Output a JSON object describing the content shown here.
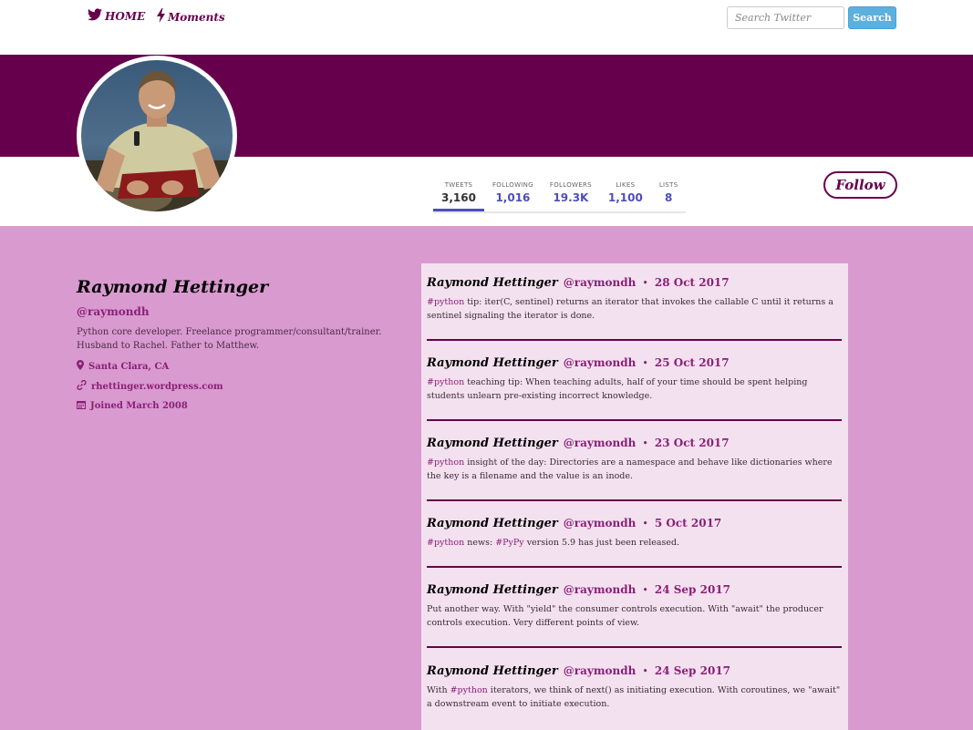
{
  "nav": {
    "home_label": "HOME",
    "moments_label": "Moments",
    "home_icon": "twitter-bird-icon",
    "moments_icon": "lightning-bolt-icon"
  },
  "search": {
    "placeholder": "Search Twitter",
    "button_label": "Search"
  },
  "colors": {
    "brand": "#66004c",
    "content_bg": "#d99ad0",
    "feed_bg": "#f4e1f0",
    "accent_link": "#8a1f77",
    "search_button": "#5bb0de"
  },
  "stats": [
    {
      "label": "TWEETS",
      "value": "3,160",
      "active": true
    },
    {
      "label": "FOLLOWING",
      "value": "1,016",
      "active": false
    },
    {
      "label": "FOLLOWERS",
      "value": "19.3K",
      "active": false
    },
    {
      "label": "LIKES",
      "value": "1,100",
      "active": false
    },
    {
      "label": "LISTS",
      "value": "8",
      "active": false
    }
  ],
  "follow_label": "Follow",
  "profile": {
    "name": "Raymond Hettinger",
    "handle": "@raymondh",
    "bio": "Python core developer. Freelance programmer/consultant/trainer. Husband to Rachel. Father to Matthew.",
    "location": "Santa Clara, CA",
    "website": "rhettinger.wordpress.com",
    "joined": "Joined March 2008",
    "location_icon": "map-marker-icon",
    "website_icon": "link-icon",
    "joined_icon": "calendar-icon"
  },
  "tweets": [
    {
      "name": "Raymond Hettinger",
      "handle": "@raymondh",
      "date": "28 Oct 2017",
      "parts": [
        [
          "#python",
          true
        ],
        [
          " tip: iter(C, sentinel) returns an iterator that invokes the callable C until it returns a sentinel signaling the iterator is done.",
          false
        ]
      ]
    },
    {
      "name": "Raymond Hettinger",
      "handle": "@raymondh",
      "date": "25 Oct 2017",
      "parts": [
        [
          "#python",
          true
        ],
        [
          " teaching tip: When teaching adults, half of your time should be spent helping students unlearn pre-existing incorrect knowledge.",
          false
        ]
      ]
    },
    {
      "name": "Raymond Hettinger",
      "handle": "@raymondh",
      "date": "23 Oct 2017",
      "parts": [
        [
          "#python",
          true
        ],
        [
          " insight of the day: Directories are a namespace and behave like dictionaries where the key is a filename and the value is an inode.",
          false
        ]
      ]
    },
    {
      "name": "Raymond Hettinger",
      "handle": "@raymondh",
      "date": "5 Oct 2017",
      "parts": [
        [
          "#python",
          true
        ],
        [
          " news: ",
          false
        ],
        [
          "#PyPy",
          true
        ],
        [
          " version 5.9 has just been released.",
          false
        ]
      ]
    },
    {
      "name": "Raymond Hettinger",
      "handle": "@raymondh",
      "date": "24 Sep 2017",
      "parts": [
        [
          "Put another way. With \"yield\" the consumer controls execution. With \"await\" the producer controls execution. Very different points of view.",
          false
        ]
      ]
    },
    {
      "name": "Raymond Hettinger",
      "handle": "@raymondh",
      "date": "24 Sep 2017",
      "parts": [
        [
          "With ",
          false
        ],
        [
          "#python",
          true
        ],
        [
          " iterators, we think of next() as initiating execution. With coroutines, we \"await\" a downstream event to initiate execution.",
          false
        ]
      ]
    }
  ]
}
